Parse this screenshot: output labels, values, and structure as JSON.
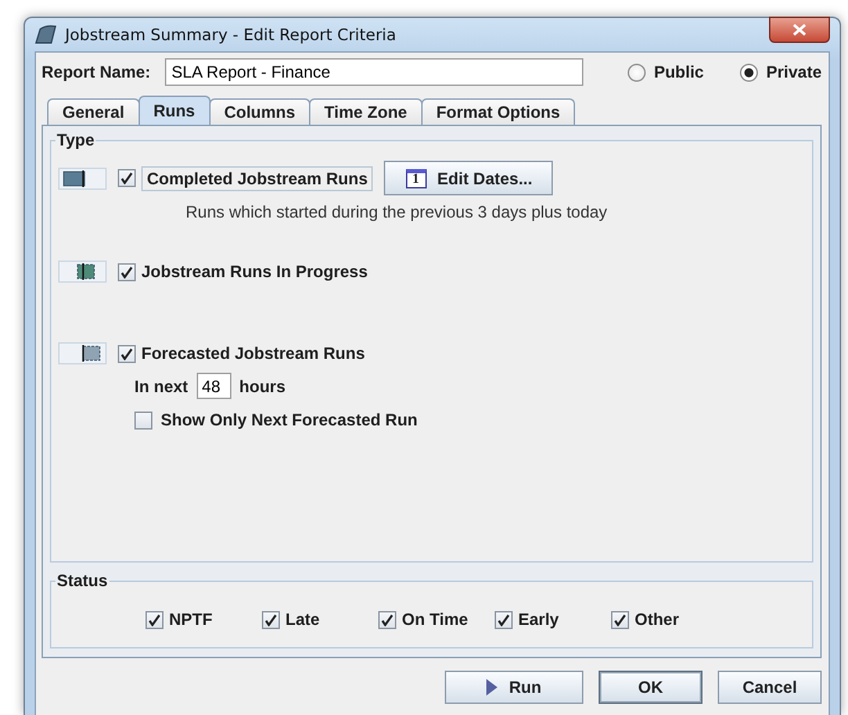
{
  "window": {
    "title": "Jobstream Summary - Edit Report Criteria"
  },
  "report_name": {
    "label": "Report Name:",
    "value": "SLA Report - Finance"
  },
  "visibility": [
    {
      "label": "Public",
      "selected": false
    },
    {
      "label": "Private",
      "selected": true
    }
  ],
  "tabs": [
    {
      "label": "General",
      "selected": false
    },
    {
      "label": "Runs",
      "selected": true
    },
    {
      "label": "Columns",
      "selected": false
    },
    {
      "label": "Time Zone",
      "selected": false
    },
    {
      "label": "Format Options",
      "selected": false
    }
  ],
  "type_group": {
    "title": "Type",
    "completed": {
      "label": "Completed Jobstream Runs",
      "checked": true,
      "button": "Edit Dates...",
      "calendar_day": "1",
      "description": "Runs which started during the previous 3 days plus today"
    },
    "in_progress": {
      "label": "Jobstream Runs In Progress",
      "checked": true
    },
    "forecasted": {
      "label": "Forecasted Jobstream Runs",
      "checked": true,
      "prefix": "In next",
      "hours": "48",
      "suffix": "hours",
      "next_only": {
        "label": "Show Only Next Forecasted Run",
        "checked": false
      }
    }
  },
  "status_group": {
    "title": "Status",
    "items": [
      {
        "label": "NPTF",
        "checked": true
      },
      {
        "label": "Late",
        "checked": true
      },
      {
        "label": "On Time",
        "checked": true
      },
      {
        "label": "Early",
        "checked": true
      },
      {
        "label": "Other",
        "checked": true
      }
    ]
  },
  "buttons": [
    {
      "label": "Run",
      "kind": "run"
    },
    {
      "label": "OK",
      "kind": "default"
    },
    {
      "label": "Cancel",
      "kind": "plain"
    }
  ]
}
